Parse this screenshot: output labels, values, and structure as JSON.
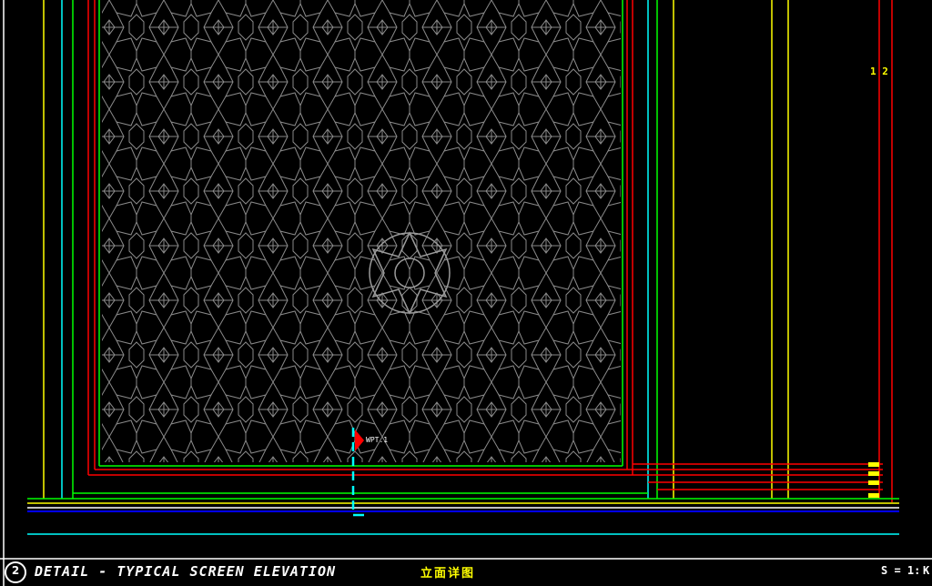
{
  "drawing": {
    "detail_number": "2",
    "title": "DETAIL - TYPICAL SCREEN ELEVATION",
    "chinese_title": "立面详图",
    "scale_text": "S = 1:",
    "scale_suffix": "K",
    "callout_tag": "WPT.1",
    "side_tag": "1 2",
    "colors": {
      "background": "#000000",
      "pattern": "#8a8a8a",
      "red": "#ff0000",
      "green": "#00ff00",
      "cyan": "#00ffff",
      "yellow": "#ffff00",
      "white": "#ffffff",
      "blue": "#0000ff"
    }
  }
}
